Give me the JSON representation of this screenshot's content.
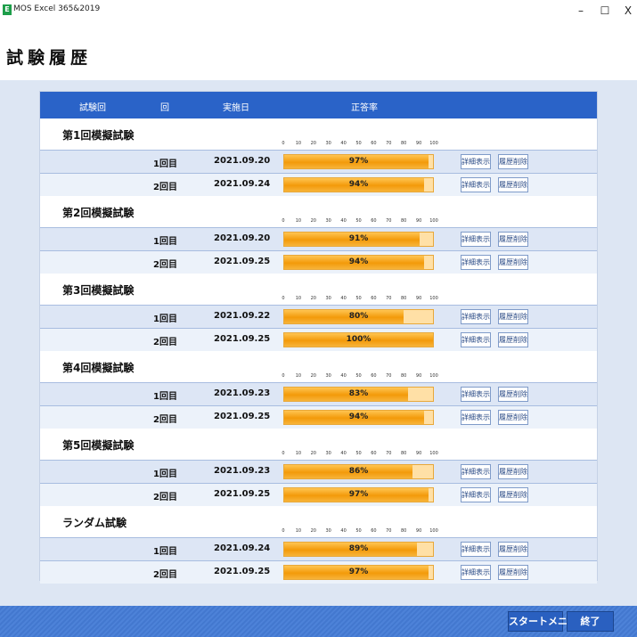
{
  "window": {
    "app_icon": "E",
    "title": "MOS Excel 365&2019",
    "minimize": "–",
    "maximize": "☐",
    "close": "X"
  },
  "page_title": "試験履歴",
  "columns": {
    "exam": "試験回",
    "attempt": "回",
    "date": "実施日",
    "rate": "正答率"
  },
  "scale_ticks": [
    "0",
    "10",
    "20",
    "30",
    "40",
    "50",
    "60",
    "70",
    "80",
    "90",
    "100"
  ],
  "buttons": {
    "detail": "詳細表示",
    "delete": "履歴削除"
  },
  "groups": [
    {
      "title": "第1回模擬試験",
      "rows": [
        {
          "attempt": "1回目",
          "date": "2021.09.20",
          "score": 97,
          "score_label": "97%"
        },
        {
          "attempt": "2回目",
          "date": "2021.09.24",
          "score": 94,
          "score_label": "94%"
        }
      ]
    },
    {
      "title": "第2回模擬試験",
      "rows": [
        {
          "attempt": "1回目",
          "date": "2021.09.20",
          "score": 91,
          "score_label": "91%"
        },
        {
          "attempt": "2回目",
          "date": "2021.09.25",
          "score": 94,
          "score_label": "94%"
        }
      ]
    },
    {
      "title": "第3回模擬試験",
      "rows": [
        {
          "attempt": "1回目",
          "date": "2021.09.22",
          "score": 80,
          "score_label": "80%"
        },
        {
          "attempt": "2回目",
          "date": "2021.09.25",
          "score": 100,
          "score_label": "100%"
        }
      ]
    },
    {
      "title": "第4回模擬試験",
      "rows": [
        {
          "attempt": "1回目",
          "date": "2021.09.23",
          "score": 83,
          "score_label": "83%"
        },
        {
          "attempt": "2回目",
          "date": "2021.09.25",
          "score": 94,
          "score_label": "94%"
        }
      ]
    },
    {
      "title": "第5回模擬試験",
      "rows": [
        {
          "attempt": "1回目",
          "date": "2021.09.23",
          "score": 86,
          "score_label": "86%"
        },
        {
          "attempt": "2回目",
          "date": "2021.09.25",
          "score": 97,
          "score_label": "97%"
        }
      ]
    },
    {
      "title": "ランダム試験",
      "rows": [
        {
          "attempt": "1回目",
          "date": "2021.09.24",
          "score": 89,
          "score_label": "89%"
        },
        {
          "attempt": "2回目",
          "date": "2021.09.25",
          "score": 97,
          "score_label": "97%"
        }
      ]
    }
  ],
  "footer": {
    "start_menu": "スタートメニュー",
    "exit": "終了"
  }
}
